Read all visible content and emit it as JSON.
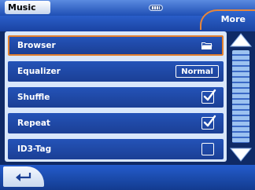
{
  "app": {
    "title": "Music"
  },
  "header": {
    "more_label": "More"
  },
  "menu": {
    "items": [
      {
        "label": "Browser",
        "control": "folder-icon",
        "selected": true
      },
      {
        "label": "Equalizer",
        "control": "value",
        "value": "Normal"
      },
      {
        "label": "Shuffle",
        "control": "checkbox",
        "checked": true
      },
      {
        "label": "Repeat",
        "control": "checkbox",
        "checked": true
      },
      {
        "label": "ID3-Tag",
        "control": "checkbox",
        "checked": false
      }
    ]
  },
  "scrollbar": {
    "up_icon": "arrow-up-icon",
    "down_icon": "arrow-down-icon"
  },
  "footer": {
    "back_icon": "back-arrow-icon"
  },
  "colors": {
    "accent": "#e07f2e",
    "row_bg": "#2453b8",
    "panel_bg": "#d9e7fb"
  }
}
